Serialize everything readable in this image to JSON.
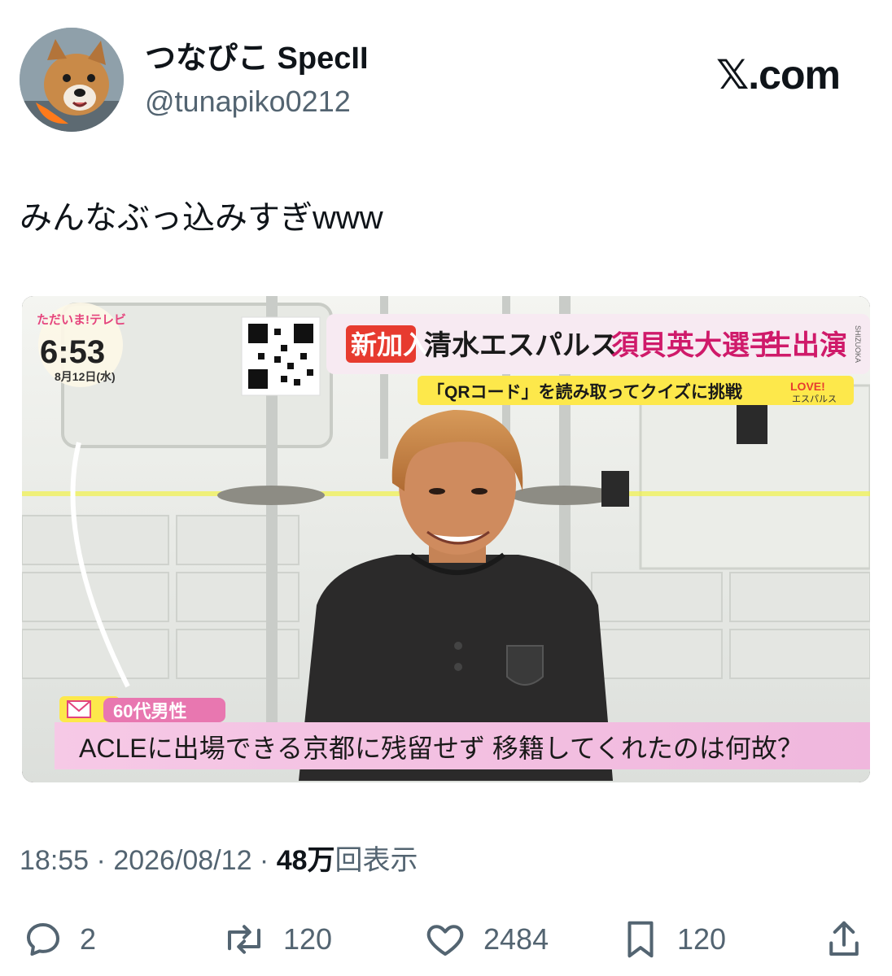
{
  "user": {
    "display_name": "つなぴこ SpecII",
    "handle": "@tunapiko0212",
    "avatar_icon": "dog-avatar"
  },
  "brand": {
    "label": "𝕏.com"
  },
  "tweet": {
    "text": "みんなぶっ込みすぎwww"
  },
  "media": {
    "program_logo": "ただいま!テレビ",
    "clock": "6:53",
    "date": "8月12日(水)",
    "tag_new": "新加入",
    "club": "清水エスパルス",
    "player": "須貝英大選手",
    "live": "生出演",
    "qr_prompt": "「QRコード」を読み取ってクイズに挑戦",
    "love_badge_top": "LOVE!",
    "love_badge_bottom": "エスパルス",
    "side_label": "SHIZUOKA",
    "viewer_tag": "60代男性",
    "viewer_question": "ACLEに出場できる京都に残留せず 移籍してくれたのは何故？"
  },
  "meta": {
    "time": "18:55",
    "sep": " · ",
    "date": "2026/08/12",
    "views_count": "48",
    "views_unit": "万",
    "views_suffix": "回表示"
  },
  "actions": {
    "replies": "2",
    "retweets": "120",
    "likes": "2484",
    "bookmarks": "120"
  }
}
